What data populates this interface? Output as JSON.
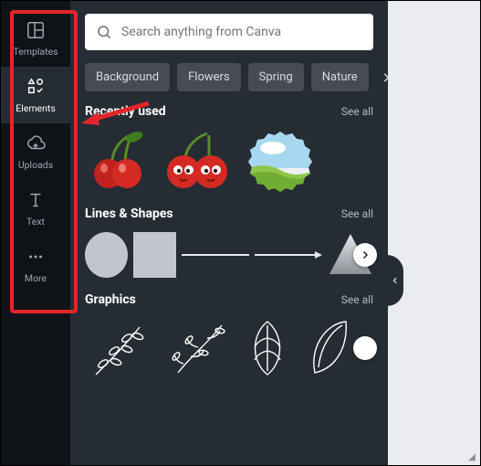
{
  "sidebar": {
    "items": [
      {
        "label": "Templates"
      },
      {
        "label": "Elements"
      },
      {
        "label": "Uploads"
      },
      {
        "label": "Text"
      },
      {
        "label": "More"
      }
    ]
  },
  "search": {
    "placeholder": "Search anything from Canva",
    "value": ""
  },
  "chips": [
    "Background",
    "Flowers",
    "Spring",
    "Nature"
  ],
  "sections": {
    "recent": {
      "title": "Recently used",
      "see_all": "See all"
    },
    "lines": {
      "title": "Lines & Shapes",
      "see_all": "See all"
    },
    "graphics": {
      "title": "Graphics",
      "see_all": "See all"
    }
  }
}
